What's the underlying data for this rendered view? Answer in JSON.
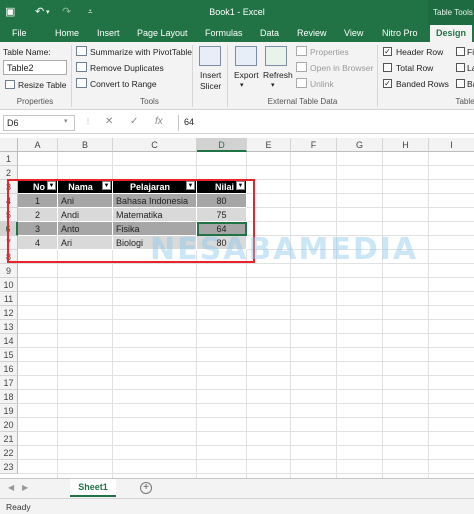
{
  "window": {
    "title": "Book1 - Excel",
    "context_tab_group": "Table Tools"
  },
  "quick_access": {
    "save_icon": "save-icon",
    "undo_icon": "undo-icon",
    "redo_icon": "redo-icon",
    "customize_icon": "customize-icon"
  },
  "tabs": [
    "File",
    "Home",
    "Insert",
    "Page Layout",
    "Formulas",
    "Data",
    "Review",
    "View",
    "Nitro Pro",
    "Design"
  ],
  "ribbon": {
    "properties": {
      "table_name_label": "Table Name:",
      "table_name_value": "Table2",
      "resize_label": "Resize Table",
      "group_label": "Properties"
    },
    "tools": {
      "summarize": "Summarize with PivotTable",
      "remove_dup": "Remove Duplicates",
      "convert": "Convert to Range",
      "group_label": "Tools"
    },
    "insert_slicer": {
      "line1": "Insert",
      "line2": "Slicer"
    },
    "external": {
      "export": "Export",
      "refresh": "Refresh",
      "properties": "Properties",
      "open_browser": "Open in Browser",
      "unlink": "Unlink",
      "group_label": "External Table Data"
    },
    "style_options": {
      "header_row": "Header Row",
      "total_row": "Total Row",
      "banded_rows": "Banded Rows",
      "header_row_checked": true,
      "total_row_checked": false,
      "banded_rows_checked": true,
      "cut_labels": [
        "Fi",
        "La",
        "Ba"
      ],
      "group_label": "Table"
    }
  },
  "formula_bar": {
    "name_box": "D6",
    "cancel": "✕",
    "enter": "✓",
    "fx": "fx",
    "value": "64"
  },
  "columns": [
    "A",
    "B",
    "C",
    "D",
    "E",
    "F",
    "G",
    "H",
    "I"
  ],
  "rows": [
    "1",
    "2",
    "3",
    "4",
    "5",
    "6",
    "7",
    "8",
    "9",
    "10",
    "11",
    "12",
    "13",
    "14",
    "15",
    "16",
    "17",
    "18",
    "19",
    "20",
    "21",
    "22",
    "23"
  ],
  "table": {
    "headers": [
      "No",
      "Nama",
      "Pelajaran",
      "Nilai"
    ],
    "rows": [
      [
        "1",
        "Ani",
        "Bahasa Indonesia",
        "80"
      ],
      [
        "2",
        "Andi",
        "Matematika",
        "75"
      ],
      [
        "3",
        "Anto",
        "Fisika",
        "64"
      ],
      [
        "4",
        "Ari",
        "Biologi",
        "80"
      ]
    ]
  },
  "watermark": "NESABAMEDIA",
  "sheet_tabs": [
    "Sheet1"
  ],
  "status": "Ready",
  "colors": {
    "excel_green": "#217346",
    "highlight_red": "#e8232a",
    "band_dark": "#a6a6a6",
    "band_light": "#d9d9d9"
  }
}
